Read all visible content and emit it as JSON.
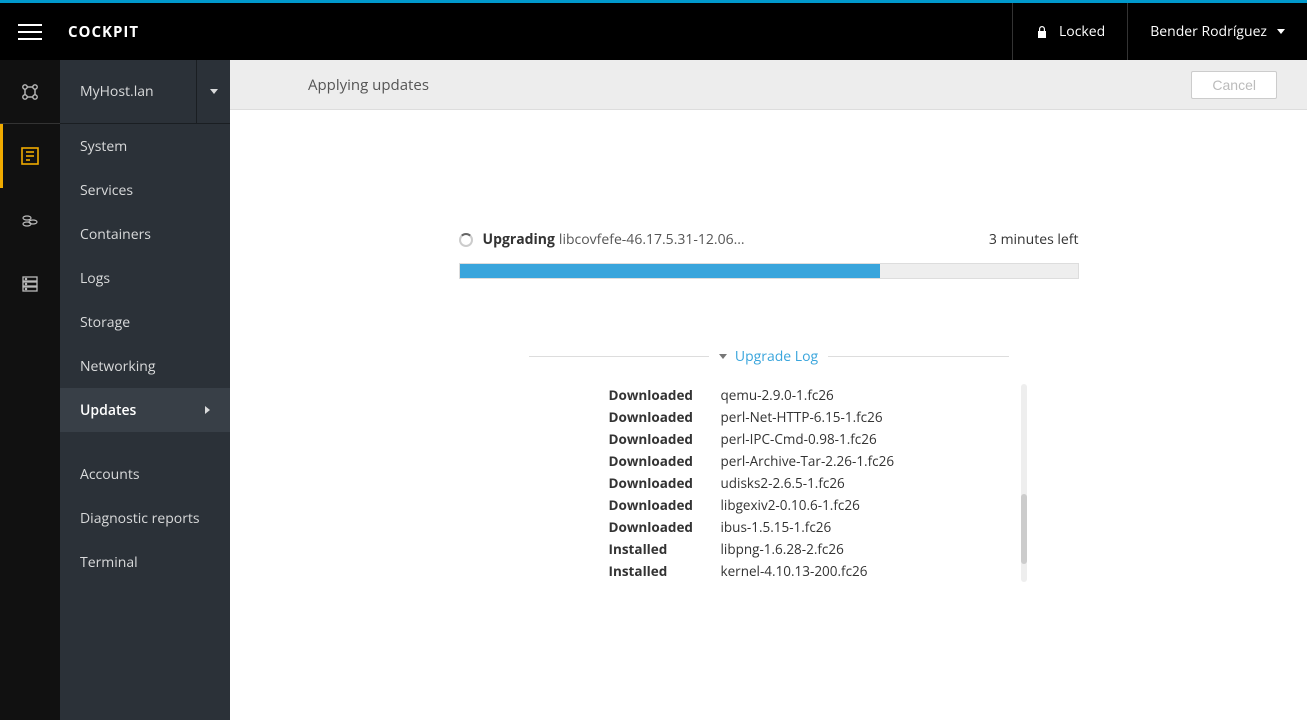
{
  "header": {
    "brand": "COCKPIT",
    "locked": "Locked",
    "user": "Bender Rodríguez"
  },
  "sidebar": {
    "host": "MyHost.lan",
    "groups": [
      [
        "System",
        "Services",
        "Containers",
        "Logs",
        "Storage",
        "Networking",
        "Updates"
      ],
      [
        "Accounts",
        "Diagnostic reports",
        "Terminal"
      ]
    ],
    "active": "Updates"
  },
  "main": {
    "title": "Applying updates",
    "cancel": "Cancel",
    "action": "Upgrading",
    "package": "libcovfefe-46.17.5.31-12.06...",
    "time_left": "3 minutes left",
    "progress_pct": 68,
    "log_title": "Upgrade Log",
    "log": [
      {
        "status": "Downloaded",
        "pkg": "qemu-2.9.0-1.fc26"
      },
      {
        "status": "Downloaded",
        "pkg": "perl-Net-HTTP-6.15-1.fc26"
      },
      {
        "status": "Downloaded",
        "pkg": "perl-IPC-Cmd-0.98-1.fc26"
      },
      {
        "status": "Downloaded",
        "pkg": "perl-Archive-Tar-2.26-1.fc26"
      },
      {
        "status": "Downloaded",
        "pkg": "udisks2-2.6.5-1.fc26"
      },
      {
        "status": "Downloaded",
        "pkg": "libgexiv2-0.10.6-1.fc26"
      },
      {
        "status": "Downloaded",
        "pkg": "ibus-1.5.15-1.fc26"
      },
      {
        "status": "Installed",
        "pkg": "libpng-1.6.28-2.fc26"
      },
      {
        "status": "Installed",
        "pkg": "kernel-4.10.13-200.fc26"
      }
    ]
  }
}
